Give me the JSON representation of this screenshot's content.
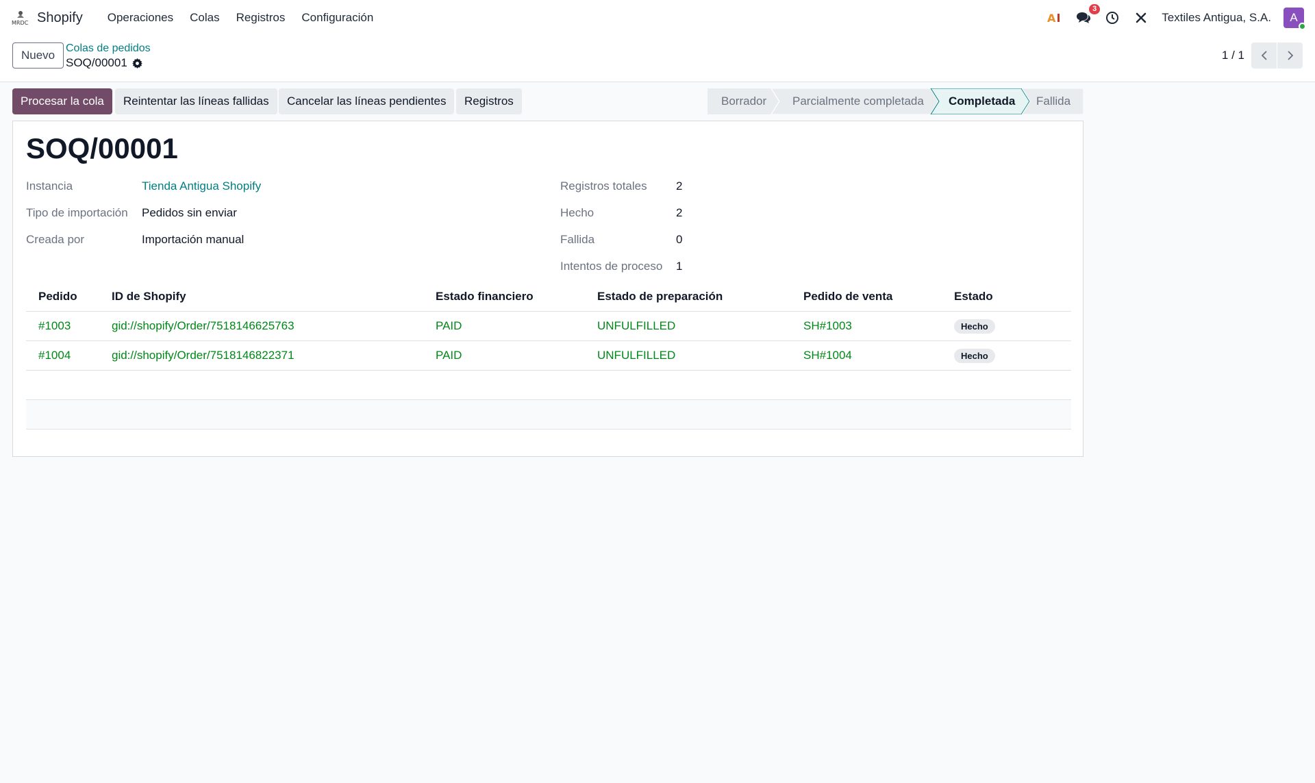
{
  "navbar": {
    "brand": "Shopify",
    "menu": [
      "Operaciones",
      "Colas",
      "Registros",
      "Configuración"
    ],
    "messages_count": "3",
    "company": "Textiles Antigua, S.A.",
    "avatar_initial": "A"
  },
  "control": {
    "new_button": "Nuevo",
    "breadcrumb_parent": "Colas de pedidos",
    "breadcrumb_current": "SOQ/00001",
    "pager": "1 / 1"
  },
  "actions": {
    "process": "Procesar la cola",
    "retry": "Reintentar las líneas fallidas",
    "cancel": "Cancelar las líneas pendientes",
    "logs": "Registros"
  },
  "statusbar": {
    "stages": [
      "Borrador",
      "Parcialmente completada",
      "Completada",
      "Fallida"
    ],
    "active": "Completada"
  },
  "record": {
    "title": "SOQ/00001",
    "instance_label": "Instancia",
    "instance_value": "Tienda Antigua Shopify",
    "import_type_label": "Tipo de importación",
    "import_type_value": "Pedidos sin enviar",
    "created_by_label": "Creada por",
    "created_by_value": "Importación manual",
    "total_label": "Registros totales",
    "total_value": "2",
    "done_label": "Hecho",
    "done_value": "2",
    "failed_label": "Fallida",
    "failed_value": "0",
    "attempts_label": "Intentos de proceso",
    "attempts_value": "1"
  },
  "table": {
    "headers": [
      "Pedido",
      "ID de Shopify",
      "Estado financiero",
      "Estado de preparación",
      "Pedido de venta",
      "Estado"
    ],
    "rows": [
      [
        "#1003",
        "gid://shopify/Order/7518146625763",
        "PAID",
        "UNFULFILLED",
        "SH#1003",
        "Hecho"
      ],
      [
        "#1004",
        "gid://shopify/Order/7518146822371",
        "PAID",
        "UNFULFILLED",
        "SH#1004",
        "Hecho"
      ]
    ]
  },
  "colors": {
    "primary": "#714b67",
    "link": "#017e84",
    "green": "#008818",
    "badge_red": "#e03e4a",
    "avatar": "#8a4fbf"
  }
}
